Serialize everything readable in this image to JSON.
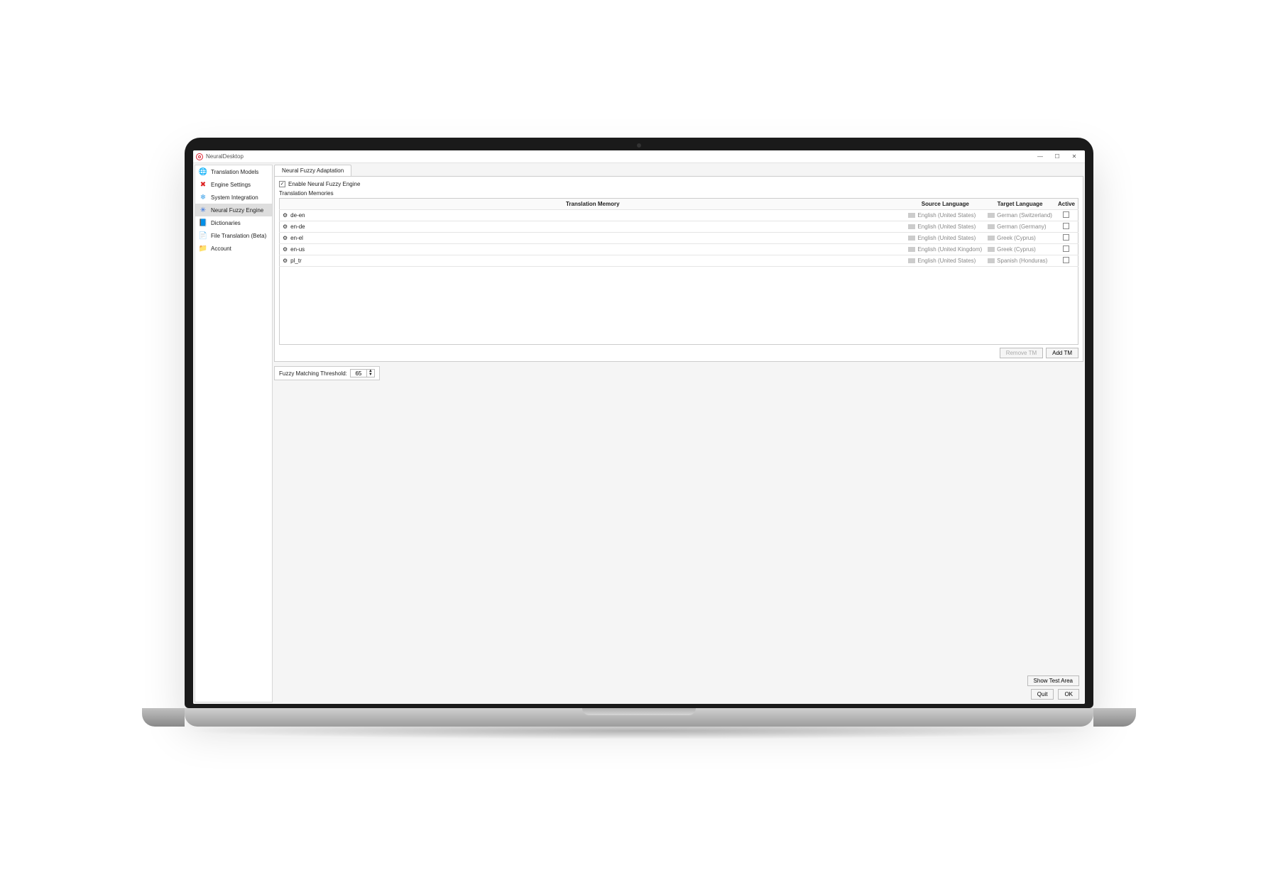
{
  "window": {
    "title": "NeuralDesktop"
  },
  "sidebar": {
    "items": [
      {
        "label": "Translation Models",
        "icon": "🌐",
        "color": "#2d6cdf"
      },
      {
        "label": "Engine Settings",
        "icon": "✖",
        "color": "#d22"
      },
      {
        "label": "System Integration",
        "icon": "❄",
        "color": "#3aa0e8"
      },
      {
        "label": "Neural Fuzzy Engine",
        "icon": "✳",
        "color": "#2d6cdf"
      },
      {
        "label": "Dictionaries",
        "icon": "📘",
        "color": "#2d6cdf"
      },
      {
        "label": "File Translation (Beta)",
        "icon": "📄",
        "color": "#2d6cdf"
      },
      {
        "label": "Account",
        "icon": "📁",
        "color": "#e0a030"
      }
    ],
    "selected_index": 3
  },
  "tab": {
    "label": "Neural Fuzzy Adaptation"
  },
  "enable": {
    "label": "Enable Neural Fuzzy Engine",
    "checked": true
  },
  "section": {
    "tm_header": "Translation Memories"
  },
  "columns": {
    "memory": "Translation Memory",
    "source": "Source Language",
    "target": "Target Language",
    "active": "Active"
  },
  "rows": [
    {
      "name": "de-en",
      "source": "English (United States)",
      "target": "German (Switzerland)",
      "active": false
    },
    {
      "name": "en-de",
      "source": "English (United States)",
      "target": "German (Germany)",
      "active": false
    },
    {
      "name": "en-el",
      "source": "English (United States)",
      "target": "Greek (Cyprus)",
      "active": false
    },
    {
      "name": "en-us",
      "source": "English (United Kingdom)",
      "target": "Greek (Cyprus)",
      "active": false
    },
    {
      "name": "pl_tr",
      "source": "English (United States)",
      "target": "Spanish (Honduras)",
      "active": false
    }
  ],
  "tm_buttons": {
    "remove": "Remove TM",
    "add": "Add TM"
  },
  "fuzzy": {
    "label": "Fuzzy Matching Threshold:",
    "value": "65"
  },
  "footer": {
    "show_test": "Show Test Area",
    "quit": "Quit",
    "ok": "OK"
  }
}
